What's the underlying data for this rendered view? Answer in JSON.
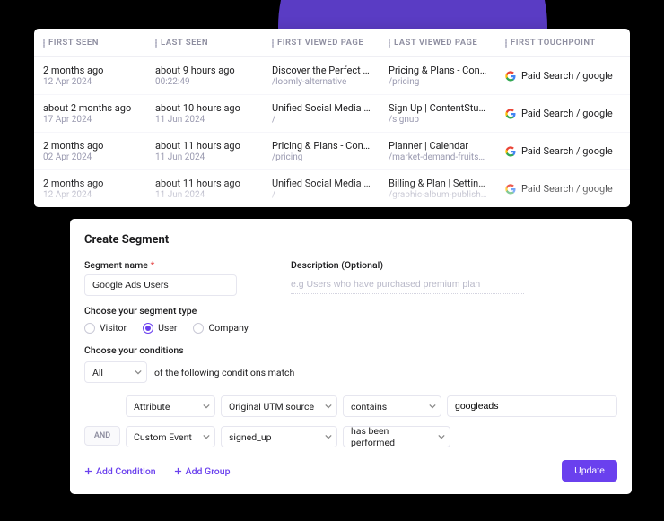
{
  "table": {
    "columns": [
      "FIRST SEEN",
      "LAST SEEN",
      "FIRST VIEWED PAGE",
      "LAST VIEWED PAGE",
      "FIRST TOUCHPOINT"
    ],
    "rows": [
      {
        "first_seen": "2 months ago",
        "first_seen_sub": "12 Apr 2024",
        "last_seen": "about 9 hours ago",
        "last_seen_sub": "00:22:49",
        "first_page": "Discover the Perfect Loomly Alternative",
        "first_page_sub": "/loomly-alternative",
        "last_page": "Pricing & Plans - ContentStudio",
        "last_page_sub": "/pricing",
        "touch": "Paid Search / google"
      },
      {
        "first_seen": "about 2 months ago",
        "first_seen_sub": "17 Apr 2024",
        "last_seen": "about 10 hours ago",
        "last_seen_sub": "11 Jun 2024",
        "first_page": "Unified Social Media Management",
        "first_page_sub": "/",
        "last_page": "Sign Up | ContentStudio",
        "last_page_sub": "/signup",
        "touch": "Paid Search / google"
      },
      {
        "first_seen": "2 months ago",
        "first_seen_sub": "02 Apr 2024",
        "last_seen": "about 11 hours ago",
        "last_seen_sub": "11 Jun 2024",
        "first_page": "Pricing & Plans - ContentStudio",
        "first_page_sub": "/pricing",
        "last_page": "Planner | Calendar",
        "last_page_sub": "/market-demand-fruits/planner",
        "touch": "Paid Search / google"
      },
      {
        "first_seen": "2 months ago",
        "first_seen_sub": "12 Apr 2024",
        "last_seen": "about 11 hours ago",
        "last_seen_sub": "11 Jun 2024",
        "first_page": "Unified Social Media Management",
        "first_page_sub": "/",
        "last_page": "Billing & Plan | Settings",
        "last_page_sub": "/graphic-album-publishing",
        "touch": "Paid Search / google"
      }
    ]
  },
  "segment": {
    "title": "Create Segment",
    "name_label": "Segment name",
    "name_value": "Google Ads Users",
    "desc_label": "Description (Optional)",
    "desc_placeholder": "e.g Users who have purchased premium plan",
    "type_label": "Choose your segment type",
    "types": [
      "Visitor",
      "User",
      "Company"
    ],
    "type_selected": "User",
    "cond_label": "Choose your conditions",
    "match_select": "All",
    "match_tail": "of the following conditions match",
    "rules": [
      {
        "kind": "Attribute",
        "field": "Original UTM source",
        "op": "contains",
        "value": "googleads"
      },
      {
        "kind": "Custom Event",
        "field": "signed_up",
        "op": "has been performed",
        "value": ""
      }
    ],
    "and_label": "AND",
    "add_condition": "Add Condition",
    "add_group": "Add Group",
    "update": "Update"
  }
}
